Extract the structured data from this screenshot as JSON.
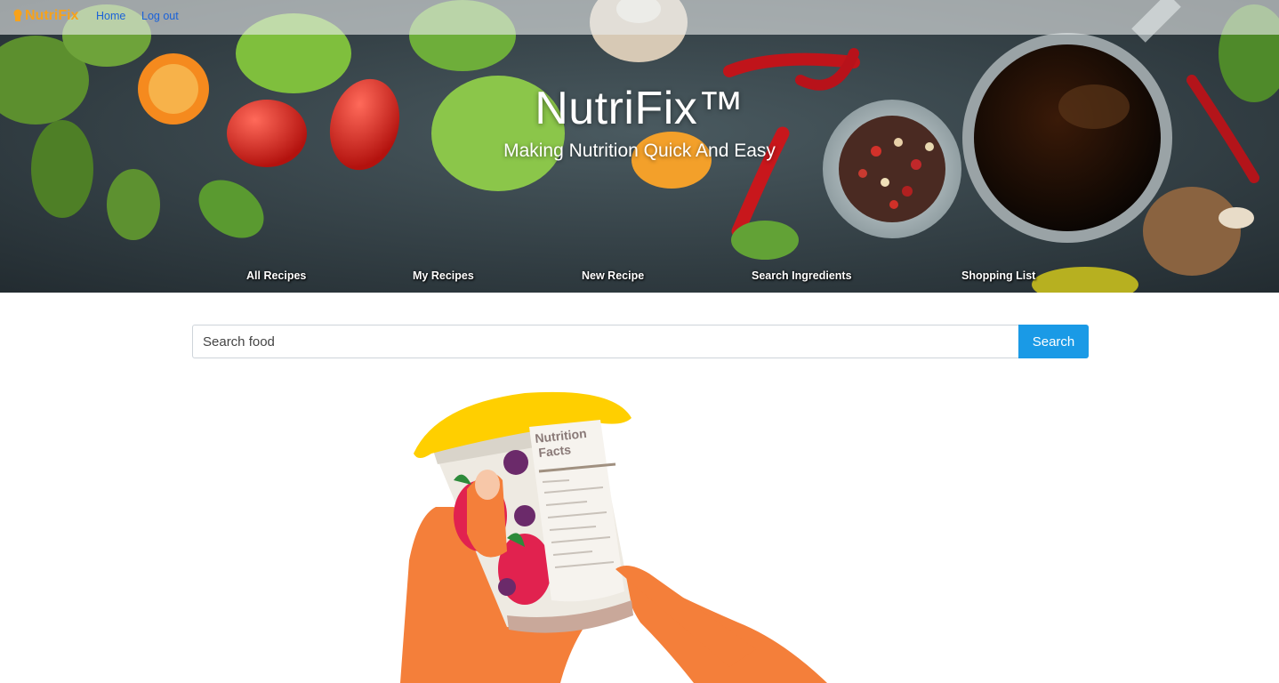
{
  "topbar": {
    "brand": "NutriFix",
    "links": {
      "home": "Home",
      "logout": "Log out"
    }
  },
  "hero": {
    "title": "NutriFix™",
    "subtitle": "Making Nutrition Quick And Easy",
    "menu": [
      "All Recipes",
      "My Recipes",
      "New Recipe",
      "Search Ingredients",
      "Shopping List"
    ]
  },
  "search": {
    "placeholder": "Search food",
    "button": "Search"
  },
  "illustration": {
    "label_line1": "Nutrition",
    "label_line2": "Facts"
  },
  "colors": {
    "brand": "#f7a21b",
    "link": "#1a62d8",
    "search_button": "#1a9ae6",
    "hand": "#f47f3a",
    "lid": "#ffcf00"
  }
}
